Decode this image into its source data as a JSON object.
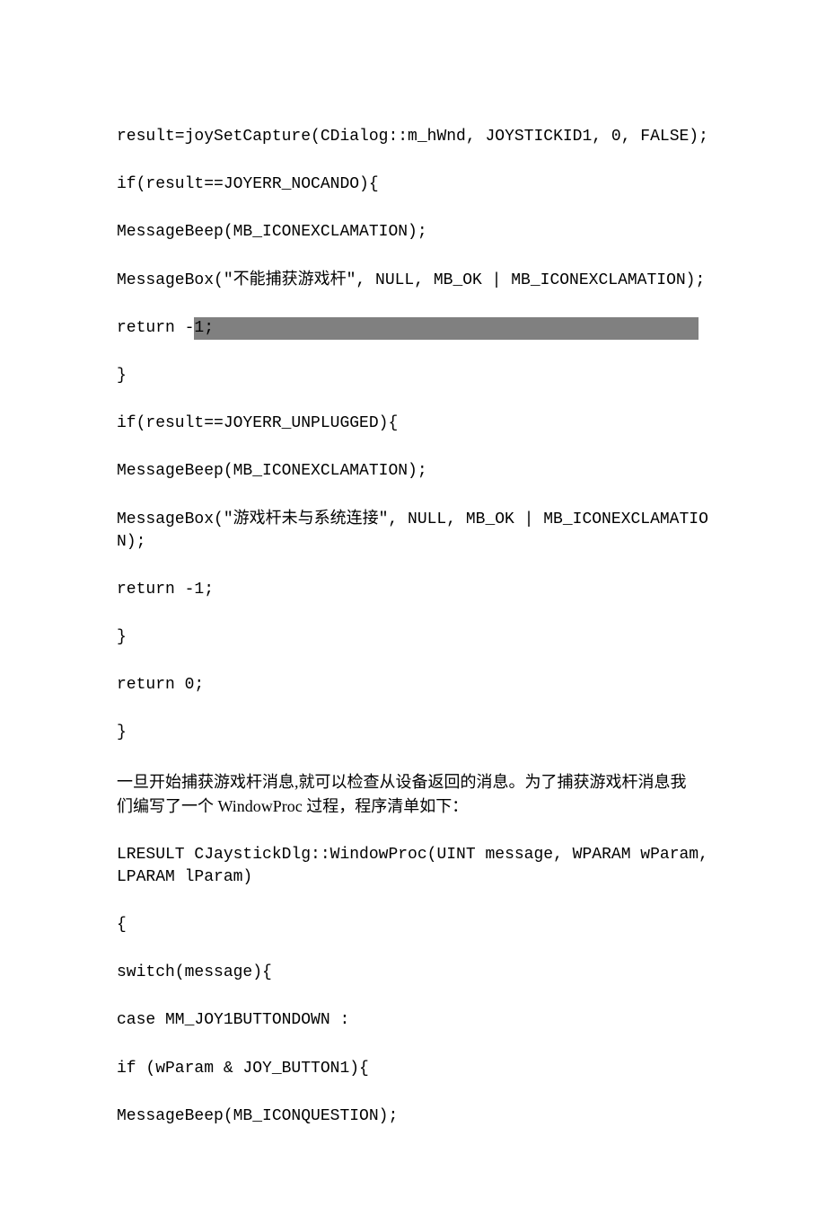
{
  "lines": {
    "l1": "result=joySetCapture(CDialog::m_hWnd, JOYSTICKID1, 0, FALSE);",
    "l2": "if(result==JOYERR_NOCANDO){",
    "l3": "MessageBeep(MB_ICONEXCLAMATION);",
    "l4": "MessageBox(\"不能捕获游戏杆\", NULL, MB_OK | MB_ICONEXCLAMATION);",
    "l5a": "return -",
    "l5b": "1;                                                  ",
    "l6": "}",
    "l7": "if(result==JOYERR_UNPLUGGED){",
    "l8": "MessageBeep(MB_ICONEXCLAMATION);",
    "l9": "MessageBox(\"游戏杆未与系统连接\", NULL, MB_OK | MB_ICONEXCLAMATION);",
    "l10": "return -1;",
    "l11": "}",
    "l12": "return 0;",
    "l13": "}",
    "p1a": "一旦开始捕获游戏杆消息,就可以检查从设备返回的消息。为了捕获游戏杆消息我",
    "p1b": "们编写了一个 WindowProc 过程，程序清单如下：",
    "l14": "LRESULT CJaystickDlg::WindowProc(UINT message, WPARAM wParam, LPARAM lParam)",
    "l15": "{",
    "l16": "switch(message){",
    "l17": "case MM_JOY1BUTTONDOWN :",
    "l18": "if (wParam & JOY_BUTTON1){",
    "l19": "MessageBeep(MB_ICONQUESTION);"
  }
}
